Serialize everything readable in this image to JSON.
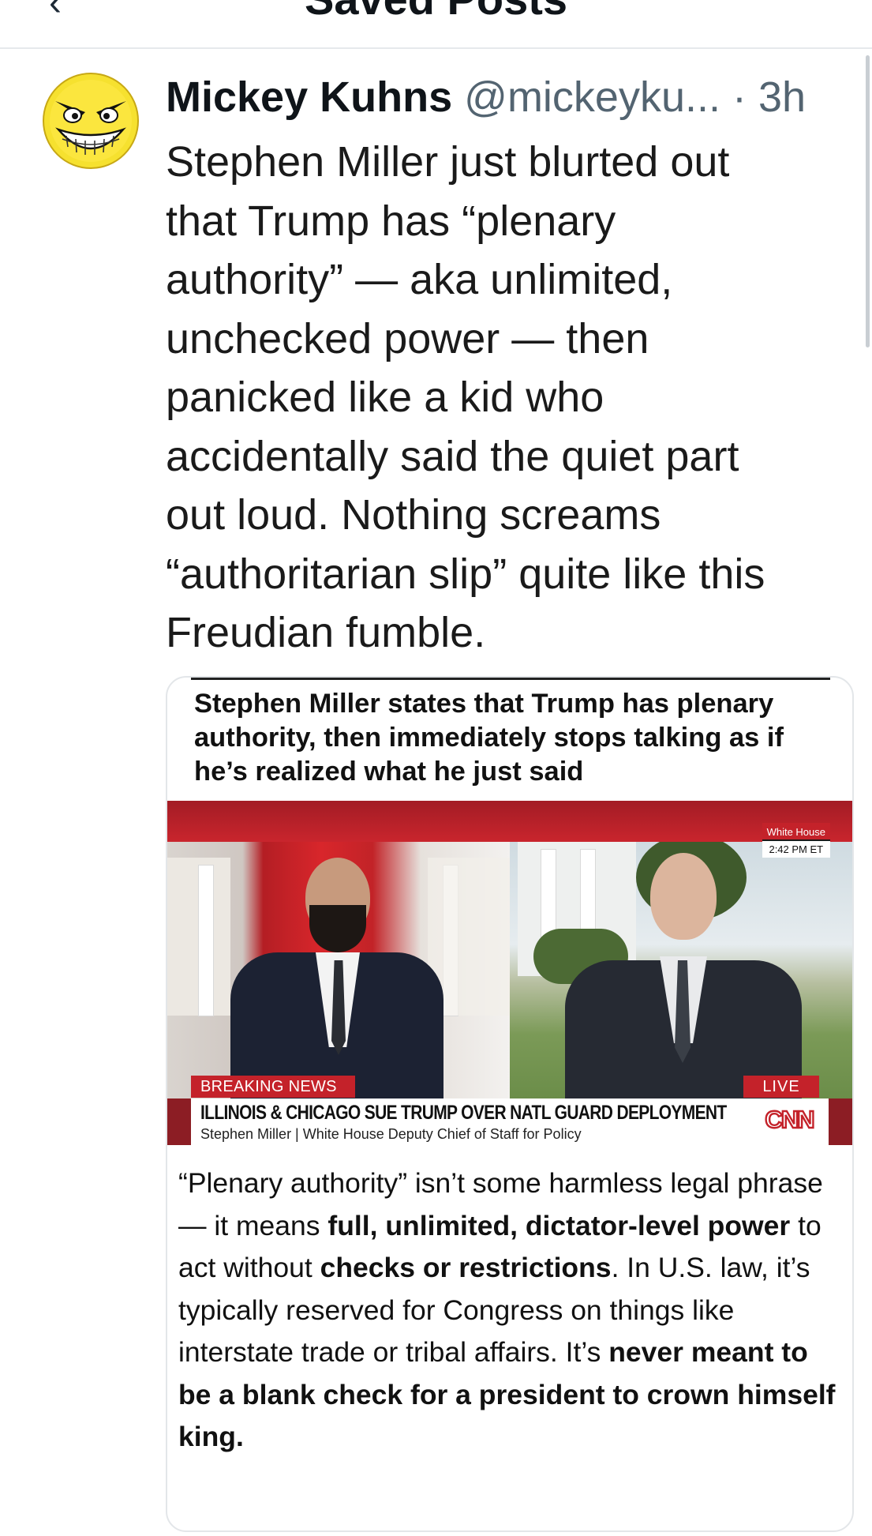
{
  "header": {
    "back_glyph": "‹",
    "title": "Saved Posts"
  },
  "post": {
    "author_name": "Mickey Kuhns",
    "author_handle": "@mickeyku...",
    "separator": "·",
    "time": "3h",
    "avatar_icon": "grinning-devil-face-avatar",
    "text_lines": [
      "Stephen Miller just blurted out",
      "that Trump has “plenary",
      "authority” — aka unlimited,",
      "unchecked power — then",
      "panicked like a kid who",
      "accidentally said the quiet part",
      "out loud. Nothing screams",
      "“authoritarian slip” quite like this",
      "Freudian fumble."
    ]
  },
  "card": {
    "caption": "Stephen Miller states that Trump has plenary authority, then immediately stops talking as if he’s realized what he just said",
    "video": {
      "location_badge": "White House",
      "clock_badge": "2:42 PM ET",
      "breaking_label": "BREAKING NEWS",
      "live_label": "LIVE",
      "headline": "ILLINOIS & CHICAGO SUE TRUMP OVER NATL GUARD DEPLOYMENT",
      "subline": "Stephen Miller  |  White House Deputy Chief of Staff for Policy",
      "network_logo": "CNN",
      "colors": {
        "cnn_red": "#c4222a"
      }
    },
    "body_segments": [
      {
        "text": "“Plenary authority” isn’t some harmless legal phrase — it means ",
        "bold": false
      },
      {
        "text": "full, unlimited, dictator-level power",
        "bold": true
      },
      {
        "text": " to act without ",
        "bold": false
      },
      {
        "text": "checks or restrictions",
        "bold": true
      },
      {
        "text": ". In U.S. law, it’s typically reserved for Congress on things like interstate trade or tribal affairs. It’s ",
        "bold": false
      },
      {
        "text": "never meant to be a blank check for a president to crown himself king.",
        "bold": true
      }
    ]
  }
}
